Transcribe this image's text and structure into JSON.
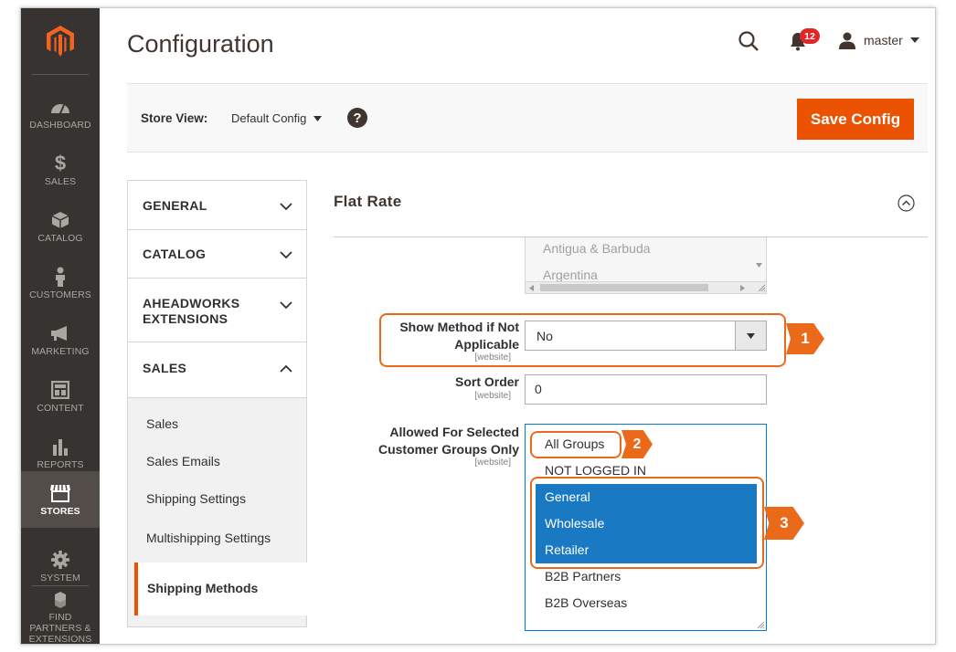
{
  "nav": {
    "items": [
      {
        "label": "DASHBOARD",
        "icon": "dashboard-gauge-icon"
      },
      {
        "label": "SALES",
        "icon": "dollar-icon"
      },
      {
        "label": "CATALOG",
        "icon": "cube-icon"
      },
      {
        "label": "CUSTOMERS",
        "icon": "person-icon"
      },
      {
        "label": "MARKETING",
        "icon": "megaphone-icon"
      },
      {
        "label": "CONTENT",
        "icon": "layout-icon"
      },
      {
        "label": "REPORTS",
        "icon": "bar-chart-icon"
      },
      {
        "label": "STORES",
        "icon": "storefront-icon"
      },
      {
        "label": "SYSTEM",
        "icon": "gear-icon"
      },
      {
        "label": "FIND PARTNERS & EXTENSIONS",
        "icon": "boxes-icon"
      }
    ],
    "active": "STORES"
  },
  "header": {
    "title": "Configuration",
    "notifications_count": "12",
    "user": "master"
  },
  "store_view": {
    "label": "Store View:",
    "value": "Default Config",
    "help": "?"
  },
  "toolbar": {
    "save_label": "Save Config"
  },
  "tabs": [
    {
      "label": "GENERAL"
    },
    {
      "label": "CATALOG"
    },
    {
      "label": "AHEADWORKS EXTENSIONS"
    },
    {
      "label": "SALES"
    }
  ],
  "subtabs": [
    "Sales",
    "Sales Emails",
    "Shipping Settings",
    "Multishipping Settings",
    "Shipping Methods"
  ],
  "section": {
    "title": "Flat Rate",
    "countries": [
      "Antigua & Barbuda",
      "Argentina"
    ],
    "fields": {
      "show_method": {
        "label": "Show Method if Not Applicable",
        "scope": "[website]",
        "value": "No"
      },
      "sort_order": {
        "label": "Sort Order",
        "scope": "[website]",
        "value": "0"
      },
      "groups": {
        "label": "Allowed For Selected Customer Groups Only",
        "scope": "[website]",
        "options": [
          "All Groups",
          "NOT LOGGED IN",
          "General",
          "Wholesale",
          "Retailer",
          "B2B Partners",
          "B2B Overseas"
        ],
        "selected": [
          "General",
          "Wholesale",
          "Retailer"
        ]
      }
    }
  },
  "callouts": [
    "1",
    "2",
    "3"
  ],
  "colors": {
    "accent": "#eb5202",
    "callout": "#eb6a1a",
    "selected": "#1979c3",
    "nav_bg": "#373330"
  }
}
